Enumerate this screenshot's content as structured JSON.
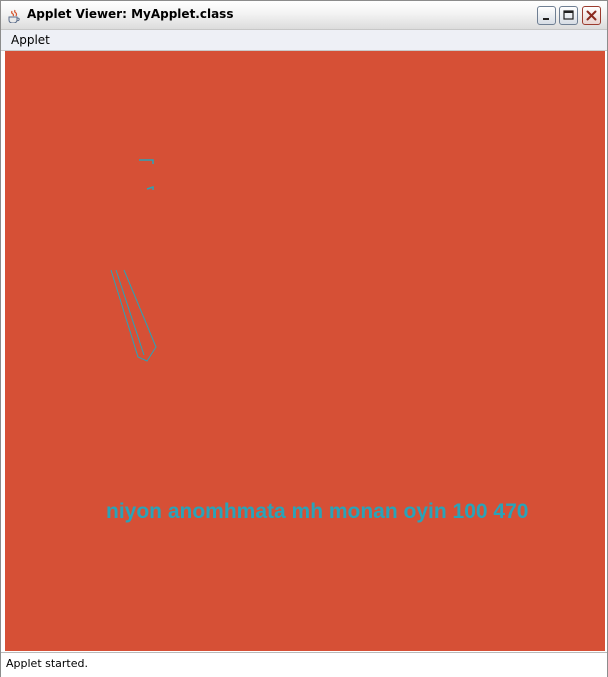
{
  "window": {
    "title": "Applet Viewer: MyApplet.class",
    "icon": "java-cup-icon",
    "controls": [
      "minimize-icon",
      "maximize-icon",
      "close-icon"
    ]
  },
  "menubar": {
    "items": [
      {
        "label": "Applet"
      }
    ]
  },
  "applet": {
    "background_color": "#d65036",
    "drawing_color": "#2aa3b8",
    "text": "niyon anomhmata mh monan oyin 100 470"
  },
  "status": {
    "text": "Applet started."
  }
}
